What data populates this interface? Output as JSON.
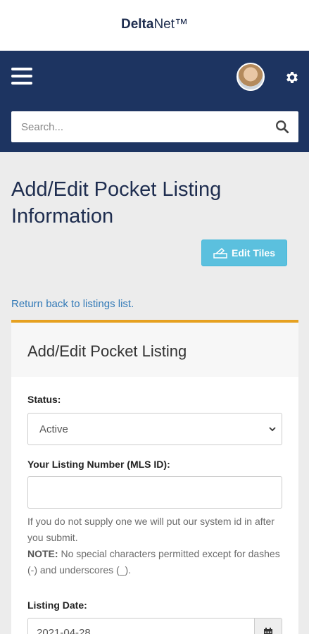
{
  "brand": {
    "bold": "Delta",
    "rest": "Net",
    "tm": "™"
  },
  "nav": {
    "menu_icon": "hamburger-menu-icon",
    "avatar_icon": "user-avatar",
    "settings_icon": "gear-icon",
    "color": "#1d3461"
  },
  "search": {
    "placeholder": "Search...",
    "icon": "search-icon"
  },
  "page": {
    "title": "Add/Edit Pocket Listing Information",
    "edit_tiles_label": "Edit Tiles",
    "back_link": "Return back to listings list."
  },
  "card": {
    "title": "Add/Edit Pocket Listing",
    "accent": "#e6a120",
    "status_label": "Status:",
    "status_value": "Active",
    "mls_label": "Your Listing Number (MLS ID):",
    "mls_value": "",
    "help_line": "If you do not supply one we will put our system id in after you submit.",
    "note_label": "NOTE:",
    "note_text": " No special characters permitted except for dashes (-) and underscores (_).",
    "date_label": "Listing Date:",
    "date_value": "2021-04-28"
  }
}
